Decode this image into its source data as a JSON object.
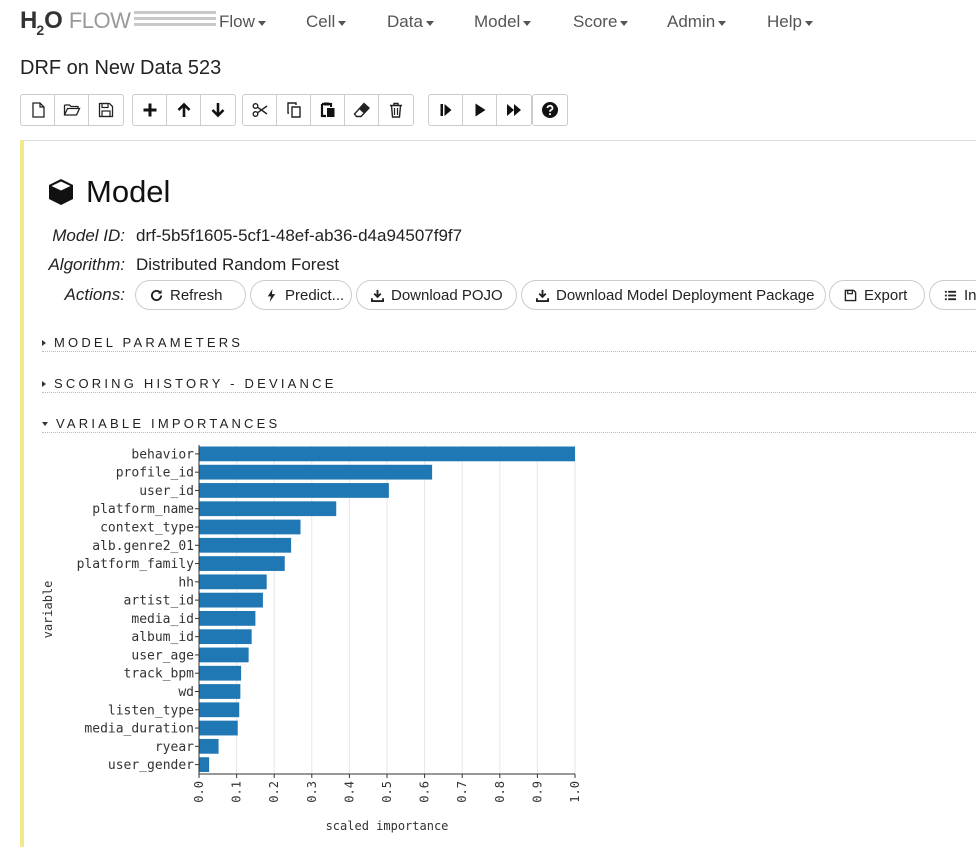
{
  "logo": {
    "h": "H",
    "two": "2",
    "o": "O",
    "flow": "FLOW"
  },
  "nav": {
    "menus": [
      {
        "label": "Flow"
      },
      {
        "label": "Cell"
      },
      {
        "label": "Data"
      },
      {
        "label": "Model"
      },
      {
        "label": "Score"
      },
      {
        "label": "Admin"
      },
      {
        "label": "Help"
      }
    ]
  },
  "document": {
    "title": "DRF on New Data 523"
  },
  "toolbar": {
    "icons": [
      "new-file-icon",
      "open-folder-icon",
      "save-icon",
      "insert-cell-icon",
      "move-up-icon",
      "move-down-icon",
      "cut-icon",
      "copy-icon",
      "paste-icon",
      "clear-icon",
      "delete-icon",
      "run-to-cell-icon",
      "run-icon",
      "run-all-icon",
      "help-icon"
    ]
  },
  "model": {
    "heading": "Model",
    "model_id_label": "Model ID:",
    "model_id": "drf-5b5f1605-5cf1-48ef-ab36-d4a94507f9f7",
    "algorithm_label": "Algorithm:",
    "algorithm": "Distributed Random Forest",
    "actions_label": "Actions:",
    "actions": [
      {
        "label": "Refresh",
        "icon": "refresh-icon"
      },
      {
        "label": "Predict...",
        "icon": "bolt-icon"
      },
      {
        "label": "Download POJO",
        "icon": "download-icon"
      },
      {
        "label": "Download Model Deployment Package",
        "icon": "download-icon"
      },
      {
        "label": "Export",
        "icon": "floppy-icon"
      },
      {
        "label": "In",
        "icon": "list-icon"
      }
    ]
  },
  "sections": [
    {
      "label": "MODEL PARAMETERS",
      "expanded": false
    },
    {
      "label": "SCORING HISTORY - DEVIANCE",
      "expanded": false
    },
    {
      "label": "VARIABLE IMPORTANCES",
      "expanded": true
    }
  ],
  "colors": {
    "bar": "#1f77b4",
    "cell_bar": "#f3e88a",
    "grid": "#e6e6e6"
  },
  "chart_data": {
    "type": "bar",
    "orientation": "horizontal",
    "xlabel": "scaled importance",
    "ylabel": "variable",
    "xlim": [
      0,
      1
    ],
    "xticks": [
      "0.0",
      "0.1",
      "0.2",
      "0.3",
      "0.4",
      "0.5",
      "0.6",
      "0.7",
      "0.8",
      "0.9",
      "1.0"
    ],
    "grid": true,
    "categories": [
      "behavior",
      "profile_id",
      "user_id",
      "platform_name",
      "context_type",
      "alb.genre2_01",
      "platform_family",
      "hh",
      "artist_id",
      "media_id",
      "album_id",
      "user_age",
      "track_bpm",
      "wd",
      "listen_type",
      "media_duration",
      "ryear",
      "user_gender"
    ],
    "values": [
      1.0,
      0.62,
      0.505,
      0.365,
      0.27,
      0.245,
      0.228,
      0.18,
      0.17,
      0.15,
      0.14,
      0.132,
      0.112,
      0.11,
      0.107,
      0.103,
      0.052,
      0.027
    ]
  }
}
